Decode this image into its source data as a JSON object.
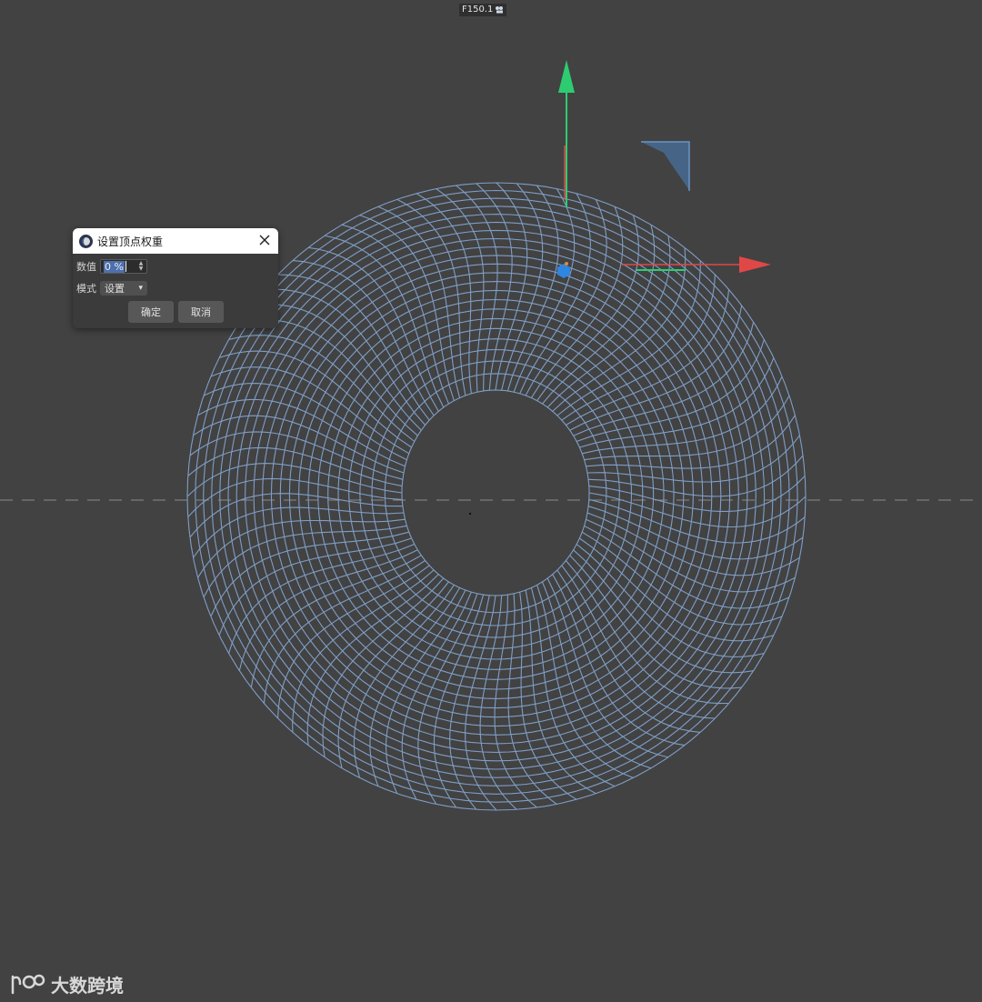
{
  "hud": {
    "text": "F150.1"
  },
  "dialog": {
    "title": "设置顶点权重",
    "value_label": "数值",
    "value": "0 %",
    "mode_label": "模式",
    "mode_selected": "设置",
    "ok_label": "确定",
    "cancel_label": "取消"
  },
  "watermark": {
    "text": "大数跨境"
  },
  "colors": {
    "background": "#424242",
    "mesh": "#7f9ec6",
    "axis_y": "#2ecc71",
    "axis_x": "#e04848",
    "handle": "#2f86e0",
    "corner_handle": "#5b82b0"
  },
  "icons": [
    "camera-icon",
    "app-logo-icon",
    "close-icon",
    "chevron-down-icon",
    "stepper-icon",
    "watermark-logo-icon"
  ]
}
